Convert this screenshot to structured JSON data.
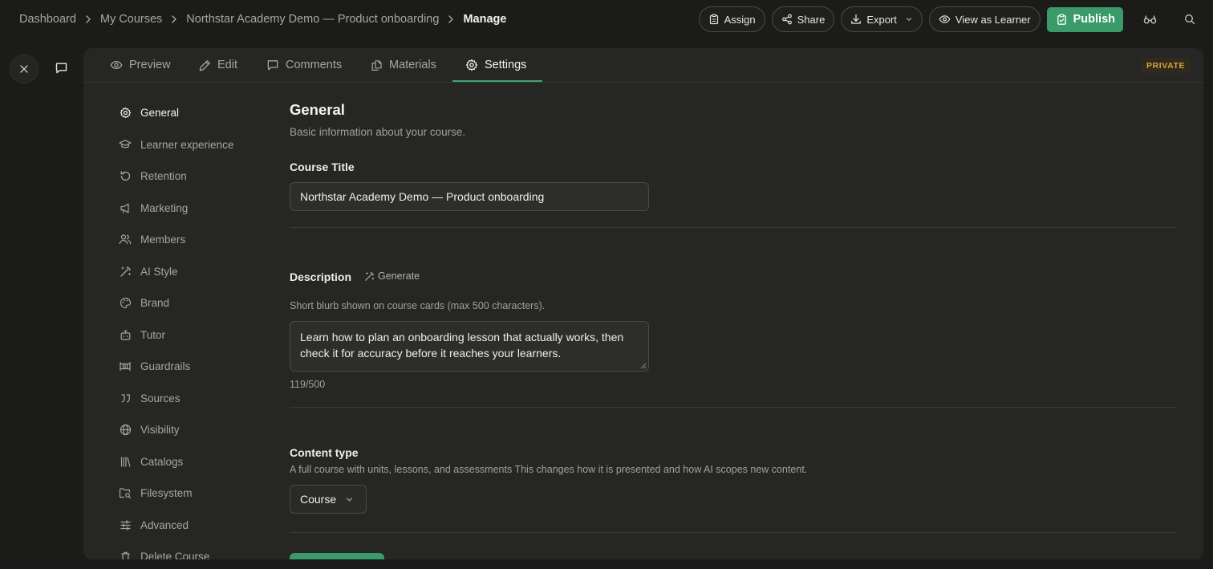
{
  "breadcrumb": [
    "Dashboard",
    "My Courses",
    "Northstar Academy Demo — Product onboarding",
    "Manage"
  ],
  "actions": {
    "assign": "Assign",
    "share": "Share",
    "export": "Export",
    "view_as_learner": "View as Learner",
    "publish": "Publish"
  },
  "tabs": [
    "Preview",
    "Edit",
    "Comments",
    "Materials",
    "Settings"
  ],
  "active_tab": "Settings",
  "visibility_badge": "PRIVATE",
  "sidenav": [
    {
      "label": "General",
      "icon": "gear-icon"
    },
    {
      "label": "Learner experience",
      "icon": "graduation-cap-icon"
    },
    {
      "label": "Retention",
      "icon": "history-icon"
    },
    {
      "label": "Marketing",
      "icon": "megaphone-icon"
    },
    {
      "label": "Members",
      "icon": "users-icon"
    },
    {
      "label": "AI Style",
      "icon": "magic-wand-icon"
    },
    {
      "label": "Brand",
      "icon": "palette-icon"
    },
    {
      "label": "Tutor",
      "icon": "bot-icon"
    },
    {
      "label": "Guardrails",
      "icon": "guardrails-icon"
    },
    {
      "label": "Sources",
      "icon": "quote-icon"
    },
    {
      "label": "Visibility",
      "icon": "globe-icon"
    },
    {
      "label": "Catalogs",
      "icon": "library-icon"
    },
    {
      "label": "Filesystem",
      "icon": "folder-search-icon"
    },
    {
      "label": "Advanced",
      "icon": "sliders-icon"
    },
    {
      "label": "Delete Course",
      "icon": "trash-icon"
    }
  ],
  "general": {
    "title": "General",
    "subtitle": "Basic information about your course.",
    "course_title_label": "Course Title",
    "course_title_value": "Northstar Academy Demo — Product onboarding",
    "description_label": "Description",
    "generate_label": "Generate",
    "description_help": "Short blurb shown on course cards (max 500 characters).",
    "description_value": "Learn how to plan an onboarding lesson that actually works, then check it for accuracy before it reaches your learners.",
    "description_count": "119/500",
    "content_type_label": "Content type",
    "content_type_help": "A full course with units, lessons, and assessments This changes how it is presented and how AI scopes new content.",
    "content_type_value": "Course"
  },
  "colors": {
    "accent_green": "#3a9a6a",
    "tab_underline": "#3fa472",
    "badge_text": "#d6a343",
    "background": "#1b1b19",
    "panel": "#262624"
  }
}
